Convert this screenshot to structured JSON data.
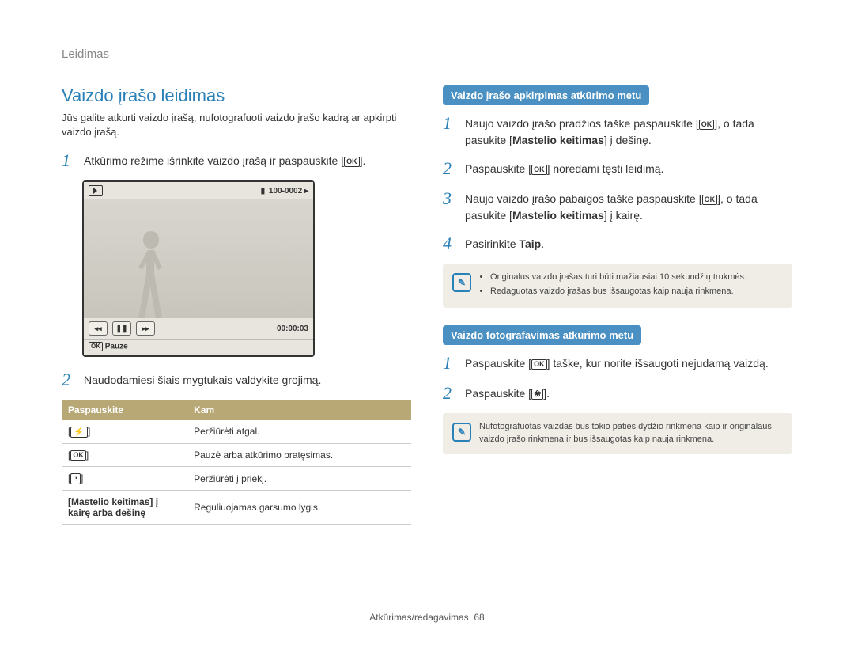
{
  "top_label": "Leidimas",
  "left": {
    "heading": "Vaizdo įrašo leidimas",
    "intro": "Jūs galite atkurti vaizdo įrašą, nufotografuoti vaizdo įrašo kadrą ar apkirpti vaizdo įrašą.",
    "step1_pre": "Atkūrimo režime išrinkite vaizdo įrašą ir paspauskite [",
    "step1_post": "].",
    "step2": "Naudodamiesi šiais mygtukais valdykite grojimą.",
    "screenshot": {
      "counter_label": "100-0002",
      "time_label": "00:00:03",
      "pause_label": "Pauzė"
    },
    "table": {
      "head_press": "Paspauskite",
      "head_to": "Kam",
      "rows": [
        {
          "press": "flash",
          "to": "Peržiūrėti atgal."
        },
        {
          "press": "ok",
          "to": "Pauzė arba atkūrimo pratęsimas."
        },
        {
          "press": "timer",
          "to": "Peržiūrėti į priekį."
        },
        {
          "press_text": "[Mastelio keitimas] į kairę arba dešinę",
          "to": "Reguliuojamas garsumo lygis."
        }
      ]
    }
  },
  "right": {
    "sub1": "Vaizdo įrašo apkirpimas atkūrimo metu",
    "s1_step1_a": "Naujo vaizdo įrašo pradžios taške paspauskite [",
    "s1_step1_b": "], o tada pasukite [",
    "s1_step1_bold1": "Mastelio keitimas",
    "s1_step1_c": "] į dešinę.",
    "s1_step2_a": "Paspauskite [",
    "s1_step2_b": "] norėdami tęsti leidimą.",
    "s1_step3_a": "Naujo vaizdo įrašo pabaigos taške paspauskite [",
    "s1_step3_b": "], o tada pasukite [",
    "s1_step3_bold": "Mastelio keitimas",
    "s1_step3_c": "] į kairę.",
    "s1_step4_a": "Pasirinkite ",
    "s1_step4_bold": "Taip",
    "s1_step4_b": ".",
    "note1_items": [
      "Originalus vaizdo įrašas turi būti mažiausiai 10 sekundžių trukmės.",
      "Redaguotas vaizdo įrašas bus išsaugotas kaip nauja rinkmena."
    ],
    "sub2": "Vaizdo fotografavimas atkūrimo metu",
    "s2_step1_a": "Paspauskite [",
    "s2_step1_b": "] taške, kur norite išsaugoti nejudamą vaizdą.",
    "s2_step2_a": "Paspauskite [",
    "s2_step2_b": "].",
    "note2": "Nufotografuotas vaizdas bus tokio paties dydžio rinkmena kaip ir originalaus vaizdo įrašo rinkmena ir bus išsaugotas kaip nauja rinkmena."
  },
  "footer_text": "Atkūrimas/redagavimas",
  "footer_page": "68"
}
